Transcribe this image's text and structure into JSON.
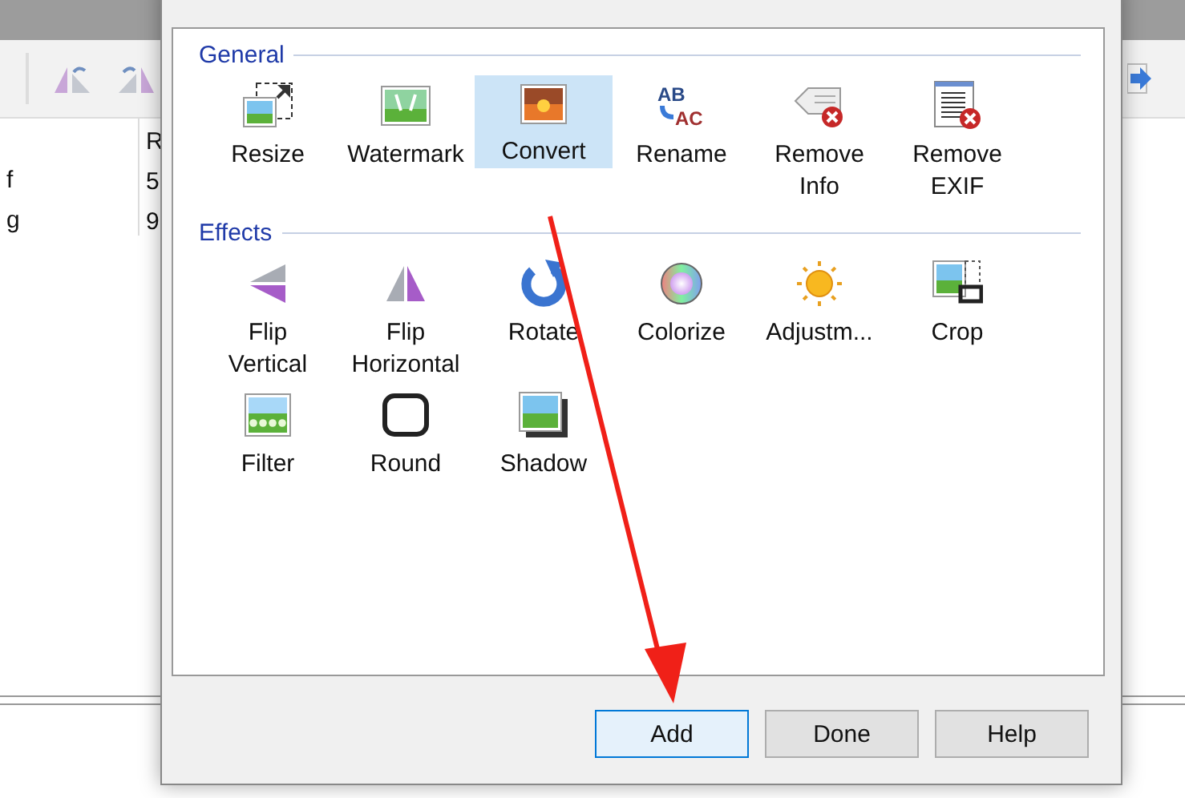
{
  "background_app": {
    "list_column_1_rows": [
      "f",
      "g"
    ],
    "list_column_2_header": "R",
    "list_column_2_rows": [
      "5",
      "9"
    ]
  },
  "dialog": {
    "sections": [
      {
        "title": "General",
        "items": [
          {
            "label": "Resize",
            "kind": "resize",
            "selected": false
          },
          {
            "label": "Watermark",
            "kind": "watermark",
            "selected": false
          },
          {
            "label": "Convert",
            "kind": "convert",
            "selected": true
          },
          {
            "label": "Rename",
            "kind": "rename",
            "selected": false,
            "icon_text": [
              "AB",
              "AC"
            ]
          },
          {
            "label": "Remove\nInfo",
            "kind": "remove-info",
            "selected": false
          },
          {
            "label": "Remove\nEXIF",
            "kind": "remove-exif",
            "selected": false
          }
        ]
      },
      {
        "title": "Effects",
        "items": [
          {
            "label": "Flip\nVertical",
            "kind": "flip-vertical",
            "selected": false
          },
          {
            "label": "Flip\nHorizontal",
            "kind": "flip-horizontal",
            "selected": false
          },
          {
            "label": "Rotate",
            "kind": "rotate",
            "selected": false
          },
          {
            "label": "Colorize",
            "kind": "colorize",
            "selected": false
          },
          {
            "label": "Adjustm...",
            "kind": "adjust",
            "selected": false
          },
          {
            "label": "Crop",
            "kind": "crop",
            "selected": false
          },
          {
            "label": "Filter",
            "kind": "filter",
            "selected": false
          },
          {
            "label": "Round",
            "kind": "round",
            "selected": false
          },
          {
            "label": "Shadow",
            "kind": "shadow",
            "selected": false
          }
        ]
      }
    ],
    "buttons": [
      {
        "label": "Add",
        "selected": true
      },
      {
        "label": "Done",
        "selected": false
      },
      {
        "label": "Help",
        "selected": false
      }
    ]
  }
}
